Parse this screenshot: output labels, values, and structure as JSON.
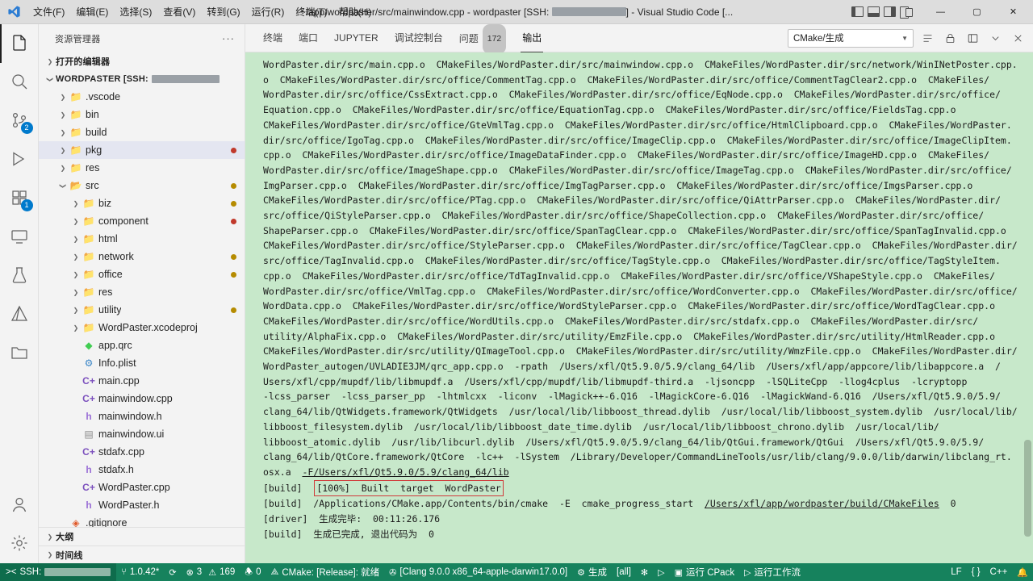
{
  "titlebar": {
    "menus": [
      "文件(F)",
      "编辑(E)",
      "选择(S)",
      "查看(V)",
      "转到(G)",
      "运行(R)",
      "终端(T)",
      "帮助(H)"
    ],
    "title_prefix": "~/app/wordpaster/src/mainwindow.cpp - wordpaster [SSH: ",
    "title_suffix": "] - Visual Studio Code [...",
    "window_buttons": {
      "minimize": "—",
      "maximize": "▢",
      "close": "✕"
    },
    "split_editor": "split-editor",
    "layout_icons": [
      "toggle-primary-sidebar",
      "toggle-panel",
      "toggle-secondary-sidebar",
      "customize-layout"
    ]
  },
  "activitybar": {
    "items": [
      {
        "name": "explorer",
        "icon": "files-icon",
        "badge": ""
      },
      {
        "name": "search",
        "icon": "search-icon",
        "badge": ""
      },
      {
        "name": "source-control",
        "icon": "source-control-icon",
        "badge": "2"
      },
      {
        "name": "run-and-debug",
        "icon": "debug-icon",
        "badge": ""
      },
      {
        "name": "extensions",
        "icon": "extensions-icon",
        "badge": "1"
      },
      {
        "name": "remote-explorer",
        "icon": "remote-icon",
        "badge": ""
      },
      {
        "name": "testing",
        "icon": "beaker-icon",
        "badge": ""
      },
      {
        "name": "cmake",
        "icon": "cmake-icon",
        "badge": ""
      },
      {
        "name": "file-manager",
        "icon": "folder-icon",
        "badge": ""
      }
    ],
    "bottom": [
      {
        "name": "accounts",
        "icon": "account-icon"
      },
      {
        "name": "settings",
        "icon": "gear-icon"
      }
    ]
  },
  "sidebar": {
    "title": "资源管理器",
    "more_actions": "···",
    "sections": [
      {
        "label": "打开的编辑器",
        "type": "section"
      },
      {
        "label": "WORDPASTER [SSH: ",
        "type": "section-redacted"
      }
    ],
    "tree": [
      {
        "label": ".vscode",
        "type": "folder",
        "depth": 1,
        "dot": ""
      },
      {
        "label": "bin",
        "type": "folder",
        "depth": 1,
        "dot": ""
      },
      {
        "label": "build",
        "type": "folder",
        "depth": 1,
        "dot": ""
      },
      {
        "label": "pkg",
        "type": "folder",
        "depth": 1,
        "dot": "#c0392b",
        "selected": true
      },
      {
        "label": "res",
        "type": "folder",
        "depth": 1,
        "dot": ""
      },
      {
        "label": "src",
        "type": "folder-open",
        "depth": 1,
        "dot": "#b58b00"
      },
      {
        "label": "biz",
        "type": "folder",
        "depth": 2,
        "dot": "#b58b00"
      },
      {
        "label": "component",
        "type": "folder",
        "depth": 2,
        "dot": "#c0392b"
      },
      {
        "label": "html",
        "type": "folder",
        "depth": 2,
        "dot": ""
      },
      {
        "label": "network",
        "type": "folder",
        "depth": 2,
        "dot": "#b58b00"
      },
      {
        "label": "office",
        "type": "folder",
        "depth": 2,
        "dot": "#b58b00"
      },
      {
        "label": "res",
        "type": "folder",
        "depth": 2,
        "dot": ""
      },
      {
        "label": "utility",
        "type": "folder",
        "depth": 2,
        "dot": "#b58b00"
      },
      {
        "label": "WordPaster.xcodeproj",
        "type": "folder",
        "depth": 2,
        "dot": ""
      },
      {
        "label": "app.qrc",
        "type": "file-qrc",
        "depth": 2,
        "dot": ""
      },
      {
        "label": "Info.plist",
        "type": "file-plist",
        "depth": 2,
        "dot": ""
      },
      {
        "label": "main.cpp",
        "type": "file-cpp",
        "depth": 2,
        "dot": ""
      },
      {
        "label": "mainwindow.cpp",
        "type": "file-cpp",
        "depth": 2,
        "dot": ""
      },
      {
        "label": "mainwindow.h",
        "type": "file-h",
        "depth": 2,
        "dot": ""
      },
      {
        "label": "mainwindow.ui",
        "type": "file-ui",
        "depth": 2,
        "dot": ""
      },
      {
        "label": "stdafx.cpp",
        "type": "file-cpp",
        "depth": 2,
        "dot": ""
      },
      {
        "label": "stdafx.h",
        "type": "file-h",
        "depth": 2,
        "dot": ""
      },
      {
        "label": "WordPaster.cpp",
        "type": "file-cpp",
        "depth": 2,
        "dot": ""
      },
      {
        "label": "WordPaster.h",
        "type": "file-h",
        "depth": 2,
        "dot": ""
      },
      {
        "label": ".gitignore",
        "type": "file-git",
        "depth": 1,
        "dot": ""
      }
    ],
    "footer": [
      {
        "label": "大纲"
      },
      {
        "label": "时间线"
      }
    ]
  },
  "panel": {
    "tabs": [
      {
        "label": "终端",
        "count": ""
      },
      {
        "label": "端口",
        "count": ""
      },
      {
        "label": "JUPYTER",
        "count": ""
      },
      {
        "label": "调试控制台",
        "count": ""
      },
      {
        "label": "问题",
        "count": "172"
      },
      {
        "label": "输出",
        "count": "",
        "active": true
      }
    ],
    "select_value": "CMake/生成",
    "actions": [
      "clear-output-icon",
      "lock-icon",
      "open-in-editor-icon",
      "chevron-down-icon",
      "close-panel-icon"
    ]
  },
  "output": {
    "lines": [
      "WordPaster.dir/src/main.cpp.o  CMakeFiles/WordPaster.dir/src/mainwindow.cpp.o  CMakeFiles/WordPaster.dir/src/network/WinINetPoster.cpp.",
      "o  CMakeFiles/WordPaster.dir/src/office/CommentTag.cpp.o  CMakeFiles/WordPaster.dir/src/office/CommentTagClear2.cpp.o  CMakeFiles/",
      "WordPaster.dir/src/office/CssExtract.cpp.o  CMakeFiles/WordPaster.dir/src/office/EqNode.cpp.o  CMakeFiles/WordPaster.dir/src/office/",
      "Equation.cpp.o  CMakeFiles/WordPaster.dir/src/office/EquationTag.cpp.o  CMakeFiles/WordPaster.dir/src/office/FieldsTag.cpp.o",
      "CMakeFiles/WordPaster.dir/src/office/GteVmlTag.cpp.o  CMakeFiles/WordPaster.dir/src/office/HtmlClipboard.cpp.o  CMakeFiles/WordPaster.",
      "dir/src/office/IgoTag.cpp.o  CMakeFiles/WordPaster.dir/src/office/ImageClip.cpp.o  CMakeFiles/WordPaster.dir/src/office/ImageClipItem.",
      "cpp.o  CMakeFiles/WordPaster.dir/src/office/ImageDataFinder.cpp.o  CMakeFiles/WordPaster.dir/src/office/ImageHD.cpp.o  CMakeFiles/",
      "WordPaster.dir/src/office/ImageShape.cpp.o  CMakeFiles/WordPaster.dir/src/office/ImageTag.cpp.o  CMakeFiles/WordPaster.dir/src/office/",
      "ImgParser.cpp.o  CMakeFiles/WordPaster.dir/src/office/ImgTagParser.cpp.o  CMakeFiles/WordPaster.dir/src/office/ImgsParser.cpp.o",
      "CMakeFiles/WordPaster.dir/src/office/PTag.cpp.o  CMakeFiles/WordPaster.dir/src/office/QiAttrParser.cpp.o  CMakeFiles/WordPaster.dir/",
      "src/office/QiStyleParser.cpp.o  CMakeFiles/WordPaster.dir/src/office/ShapeCollection.cpp.o  CMakeFiles/WordPaster.dir/src/office/",
      "ShapeParser.cpp.o  CMakeFiles/WordPaster.dir/src/office/SpanTagClear.cpp.o  CMakeFiles/WordPaster.dir/src/office/SpanTagInvalid.cpp.o",
      "CMakeFiles/WordPaster.dir/src/office/StyleParser.cpp.o  CMakeFiles/WordPaster.dir/src/office/TagClear.cpp.o  CMakeFiles/WordPaster.dir/",
      "src/office/TagInvalid.cpp.o  CMakeFiles/WordPaster.dir/src/office/TagStyle.cpp.o  CMakeFiles/WordPaster.dir/src/office/TagStyleItem.",
      "cpp.o  CMakeFiles/WordPaster.dir/src/office/TdTagInvalid.cpp.o  CMakeFiles/WordPaster.dir/src/office/VShapeStyle.cpp.o  CMakeFiles/",
      "WordPaster.dir/src/office/VmlTag.cpp.o  CMakeFiles/WordPaster.dir/src/office/WordConverter.cpp.o  CMakeFiles/WordPaster.dir/src/office/",
      "WordData.cpp.o  CMakeFiles/WordPaster.dir/src/office/WordStyleParser.cpp.o  CMakeFiles/WordPaster.dir/src/office/WordTagClear.cpp.o",
      "CMakeFiles/WordPaster.dir/src/office/WordUtils.cpp.o  CMakeFiles/WordPaster.dir/src/stdafx.cpp.o  CMakeFiles/WordPaster.dir/src/",
      "utility/AlphaFix.cpp.o  CMakeFiles/WordPaster.dir/src/utility/EmzFile.cpp.o  CMakeFiles/WordPaster.dir/src/utility/HtmlReader.cpp.o",
      "CMakeFiles/WordPaster.dir/src/utility/QImageTool.cpp.o  CMakeFiles/WordPaster.dir/src/utility/WmzFile.cpp.o  CMakeFiles/WordPaster.dir/",
      "WordPaster_autogen/UVLADIE3JM/qrc_app.cpp.o  -rpath  /Users/xfl/Qt5.9.0/5.9/clang_64/lib  /Users/xfl/app/appcore/lib/libappcore.a  /",
      "Users/xfl/cpp/mupdf/lib/libmupdf.a  /Users/xfl/cpp/mupdf/lib/libmupdf-third.a  -ljsoncpp  -lSQLiteCpp  -llog4cplus  -lcryptopp",
      "-lcss_parser  -lcss_parser_pp  -lhtmlcxx  -liconv  -lMagick++-6.Q16  -lMagickCore-6.Q16  -lMagickWand-6.Q16  /Users/xfl/Qt5.9.0/5.9/",
      "clang_64/lib/QtWidgets.framework/QtWidgets  /usr/local/lib/libboost_thread.dylib  /usr/local/lib/libboost_system.dylib  /usr/local/lib/",
      "libboost_filesystem.dylib  /usr/local/lib/libboost_date_time.dylib  /usr/local/lib/libboost_chrono.dylib  /usr/local/lib/",
      "libboost_atomic.dylib  /usr/lib/libcurl.dylib  /Users/xfl/Qt5.9.0/5.9/clang_64/lib/QtGui.framework/QtGui  /Users/xfl/Qt5.9.0/5.9/",
      "clang_64/lib/QtCore.framework/QtCore  -lc++  -lSystem  /Library/Developer/CommandLineTools/usr/lib/clang/9.0.0/lib/darwin/libclang_rt."
    ],
    "tail_line": "osx.a  -F/Users/xfl/Qt5.9.0/5.9/clang_64/lib",
    "tail_link": "-F/Users/xfl/Qt5.9.0/5.9/clang_64/lib",
    "built_prefix": "[build]  ",
    "built_highlight": "[100%]  Built  target  WordPaster",
    "cmake_line_prefix": "[build]  /Applications/CMake.app/Contents/bin/cmake  -E  cmake_progress_start  ",
    "cmake_line_link": "/Users/xfl/app/wordpaster/build/CMakeFiles",
    "cmake_line_suffix": "  0",
    "driver_line": "[driver]  生成完毕:  00:11:26.176",
    "build_done_line": "[build]  生成已完成, 退出代码为  0"
  },
  "statusbar": {
    "remote_label": "SSH: ",
    "items": [
      {
        "icon": "git-branch-icon",
        "text": "1.0.42*"
      },
      {
        "icon": "sync-icon",
        "text": ""
      },
      {
        "icon": "error-icon",
        "text": "3",
        "icon2": "warning-icon",
        "text2": "169"
      },
      {
        "icon": "bell-slash-icon",
        "text": "0"
      },
      {
        "icon": "cmake-icon",
        "text": "CMake: [Release]: 就绪"
      },
      {
        "icon": "tools-icon",
        "text": "[Clang 9.0.0 x86_64-apple-darwin17.0.0]"
      },
      {
        "icon": "gear-icon",
        "text": "生成"
      },
      {
        "icon": "",
        "text": "[all]"
      },
      {
        "icon": "bug-icon",
        "text": ""
      },
      {
        "icon": "play-icon",
        "text": ""
      },
      {
        "icon": "package-icon",
        "text": "运行 CPack"
      },
      {
        "icon": "workflow-icon",
        "text": "运行工作流"
      },
      {
        "icon": "",
        "text": "LF"
      },
      {
        "icon": "",
        "text": "{ }"
      },
      {
        "icon": "",
        "text": "C++"
      },
      {
        "icon": "bell-icon",
        "text": ""
      }
    ]
  }
}
